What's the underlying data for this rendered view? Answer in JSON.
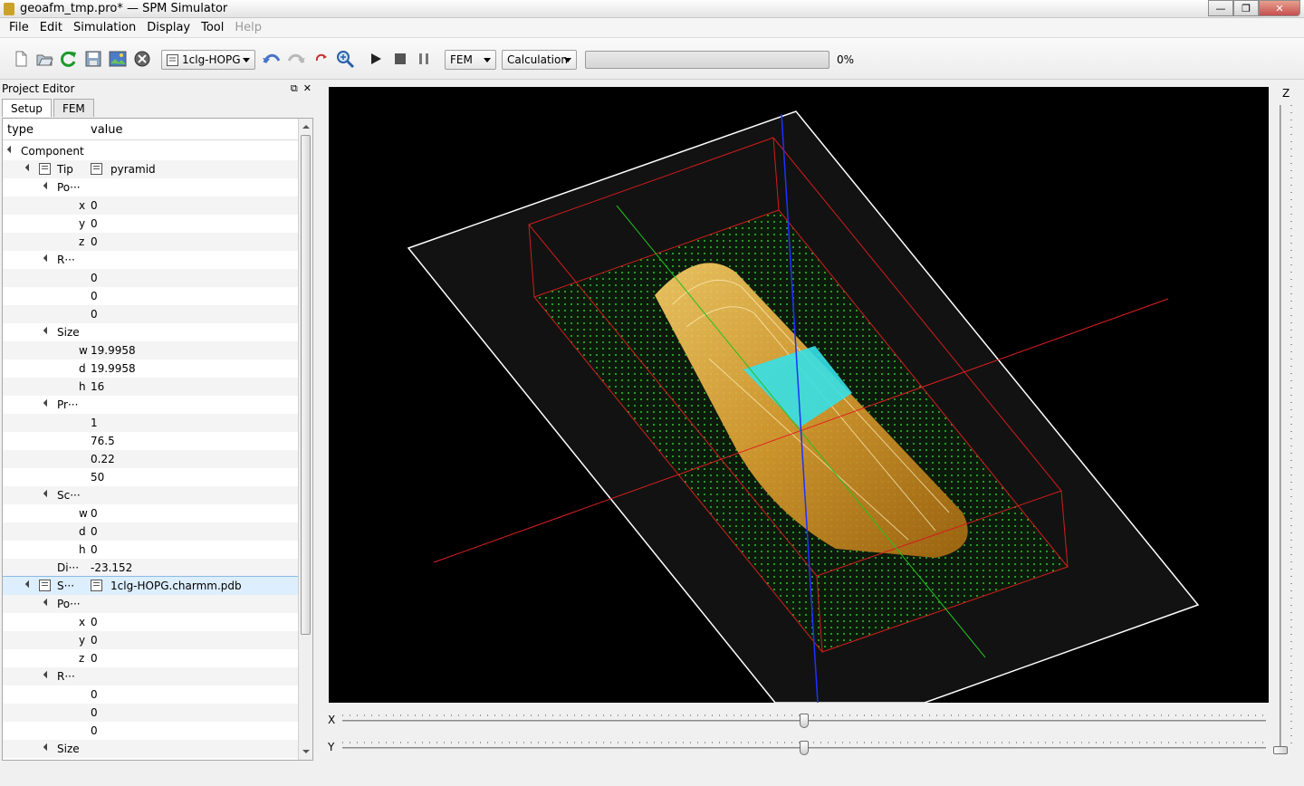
{
  "window": {
    "title": "geoafm_tmp.pro* — SPM Simulator",
    "minimize": "—",
    "maximize": "❐",
    "close": "✕"
  },
  "menu": [
    {
      "label": "File"
    },
    {
      "label": "Edit"
    },
    {
      "label": "Simulation"
    },
    {
      "label": "Display"
    },
    {
      "label": "Tool"
    },
    {
      "label": "Help",
      "disabled": true
    }
  ],
  "toolbar": {
    "component_select": "1clg-HOPG",
    "mode_select": "FEM",
    "calc_select": "Calculation",
    "progress_value": 0,
    "progress_text": "0%",
    "icons": [
      "new-file-icon",
      "open-folder-icon",
      "reload-icon",
      "save-icon",
      "save-image-icon",
      "close-project-icon",
      "undo-icon",
      "redo-icon",
      "reset-view-icon",
      "zoom-icon",
      "play-icon",
      "stop-icon",
      "pause-icon"
    ]
  },
  "editor": {
    "title": "Project Editor",
    "float_btn": "⧉",
    "close_btn": "✕",
    "tabs": [
      "Setup",
      "FEM"
    ],
    "columns": {
      "type": "type",
      "value": "value"
    },
    "rows": [
      {
        "indent": 0,
        "expander": true,
        "label": "Component",
        "value": ""
      },
      {
        "indent": 1,
        "expander": true,
        "icon": true,
        "label": "Tip",
        "value_icon": true,
        "value": "pyramid"
      },
      {
        "indent": 2,
        "expander": true,
        "label": "Po···",
        "value": ""
      },
      {
        "indent": 3,
        "label": "x",
        "value": "0"
      },
      {
        "indent": 3,
        "label": "y",
        "value": "0"
      },
      {
        "indent": 3,
        "label": "z",
        "value": "0"
      },
      {
        "indent": 2,
        "expander": true,
        "label": "R···",
        "value": ""
      },
      {
        "indent": 3,
        "label": "",
        "value": "0"
      },
      {
        "indent": 3,
        "label": "",
        "value": "0"
      },
      {
        "indent": 3,
        "label": "",
        "value": "0"
      },
      {
        "indent": 2,
        "expander": true,
        "label": "Size",
        "value": ""
      },
      {
        "indent": 3,
        "label": "w",
        "value": "19.9958"
      },
      {
        "indent": 3,
        "label": "d",
        "value": "19.9958"
      },
      {
        "indent": 3,
        "label": "h",
        "value": "16"
      },
      {
        "indent": 2,
        "expander": true,
        "label": "Pr···",
        "value": ""
      },
      {
        "indent": 3,
        "label": "",
        "value": "1"
      },
      {
        "indent": 3,
        "label": "",
        "value": "76.5"
      },
      {
        "indent": 3,
        "label": "",
        "value": "0.22"
      },
      {
        "indent": 3,
        "label": "",
        "value": "50"
      },
      {
        "indent": 2,
        "expander": true,
        "label": "Sc···",
        "value": ""
      },
      {
        "indent": 3,
        "label": "w",
        "value": "0"
      },
      {
        "indent": 3,
        "label": "d",
        "value": "0"
      },
      {
        "indent": 3,
        "label": "h",
        "value": "0"
      },
      {
        "indent": 2,
        "label": "Di···",
        "value": "-23.152"
      },
      {
        "indent": 1,
        "expander": true,
        "icon": true,
        "label": "S···",
        "value_icon": true,
        "value": "1clg-HOPG.charmm.pdb",
        "selected": true
      },
      {
        "indent": 2,
        "expander": true,
        "label": "Po···",
        "value": ""
      },
      {
        "indent": 3,
        "label": "x",
        "value": "0"
      },
      {
        "indent": 3,
        "label": "y",
        "value": "0"
      },
      {
        "indent": 3,
        "label": "z",
        "value": "0"
      },
      {
        "indent": 2,
        "expander": true,
        "label": "R···",
        "value": ""
      },
      {
        "indent": 3,
        "label": "",
        "value": "0"
      },
      {
        "indent": 3,
        "label": "",
        "value": "0"
      },
      {
        "indent": 3,
        "label": "",
        "value": "0"
      },
      {
        "indent": 2,
        "expander": true,
        "label": "Size",
        "value": ""
      }
    ]
  },
  "sliders": {
    "x_label": "X",
    "y_label": "Y",
    "z_label": "Z",
    "x_value": 0.5,
    "y_value": 0.5,
    "z_value": 0
  }
}
